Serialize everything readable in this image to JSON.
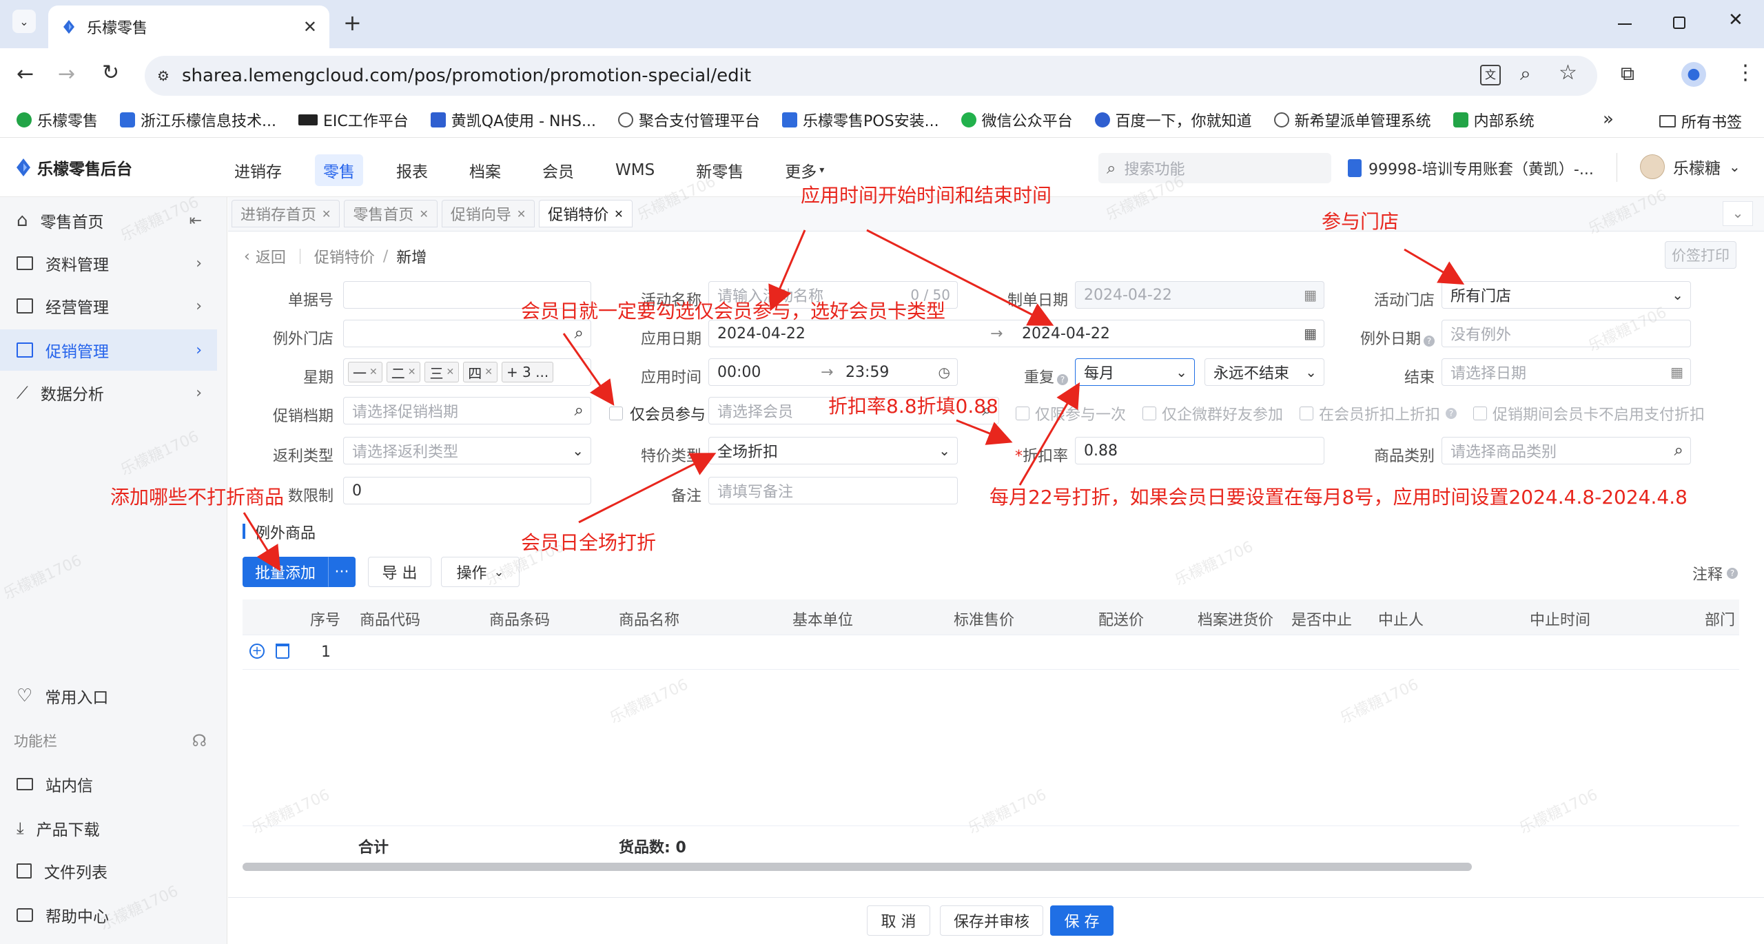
{
  "browser": {
    "tab_title": "乐檬零售",
    "url": "sharea.lemengcloud.com/pos/promotion/promotion-special/edit",
    "bookmarks": [
      {
        "label": "乐檬零售",
        "color": "#22a447"
      },
      {
        "label": "浙江乐檬信息技术...",
        "color": "#2f6bdc"
      },
      {
        "label": "EIC工作平台",
        "color": "#222222"
      },
      {
        "label": "黄凯QA使用 - NHS...",
        "color": "#2f5fd0"
      },
      {
        "label": "聚合支付管理平台",
        "color": "#555555"
      },
      {
        "label": "乐檬零售POS安装...",
        "color": "#2f6bdc"
      },
      {
        "label": "微信公众平台",
        "color": "#22b14c"
      },
      {
        "label": "百度一下，你就知道",
        "color": "#2f5fd0"
      },
      {
        "label": "新希望派单管理系统",
        "color": "#555555"
      },
      {
        "label": "内部系统",
        "color": "#22a447"
      }
    ],
    "all_bookmarks": "所有书签",
    "more_bookmarks": "»"
  },
  "app": {
    "logo": "乐檬零售后台",
    "nav": [
      "进销存",
      "零售",
      "报表",
      "档案",
      "会员",
      "WMS",
      "新零售",
      "更多"
    ],
    "nav_active": "零售",
    "search_placeholder": "搜索功能",
    "account": "99998-培训专用账套（黄凯）-...",
    "user": "乐檬糖"
  },
  "sidebar": {
    "items": [
      {
        "label": "零售首页",
        "icon": "home-icon"
      },
      {
        "label": "资料管理",
        "icon": "folder-icon"
      },
      {
        "label": "经营管理",
        "icon": "chart-box-icon"
      },
      {
        "label": "促销管理",
        "icon": "promotion-icon"
      },
      {
        "label": "数据分析",
        "icon": "line-chart-icon"
      }
    ],
    "favorites": "常用入口",
    "function_bar": "功能栏",
    "bottom_items": [
      {
        "label": "站内信",
        "icon": "mail-icon"
      },
      {
        "label": "产品下载",
        "icon": "download-icon"
      },
      {
        "label": "文件列表",
        "icon": "file-list-icon"
      },
      {
        "label": "帮助中心",
        "icon": "help-icon"
      }
    ]
  },
  "tabs": [
    "进销存首页",
    "零售首页",
    "促销向导",
    "促销特价"
  ],
  "breadcrumb": {
    "back": "返回",
    "parent": "促销特价",
    "current": "新增"
  },
  "price_print": "价签打印",
  "form": {
    "doc_no": {
      "label": "单据号",
      "value": ""
    },
    "activity_name": {
      "label": "活动名称",
      "placeholder": "请输入活动名称",
      "counter": "0 / 50"
    },
    "create_date": {
      "label": "制单日期",
      "value": "2024-04-22"
    },
    "activity_store": {
      "label": "活动门店",
      "value": "所有门店"
    },
    "exception_store": {
      "label": "例外门店",
      "value": ""
    },
    "apply_date": {
      "label": "应用日期",
      "start": "2024-04-22",
      "end": "2024-04-22",
      "sep": "→"
    },
    "exception_date": {
      "label": "例外日期",
      "placeholder": "没有例外"
    },
    "weekday": {
      "label": "星期",
      "tags": [
        "一",
        "二",
        "三",
        "四"
      ],
      "more": "+ 3 ..."
    },
    "apply_time": {
      "label": "应用时间",
      "start": "00:00",
      "end": "23:59",
      "sep": "→"
    },
    "repeat": {
      "label": "重复",
      "value": "每月",
      "end_mode": "永远不结束"
    },
    "end": {
      "label": "结束",
      "placeholder": "请选择日期"
    },
    "promo_file": {
      "label": "促销档期",
      "placeholder": "请选择促销档期"
    },
    "member_only": {
      "label": "仅会员参与",
      "placeholder": "请选择会员"
    },
    "options": [
      "仅限参与一次",
      "仅企微群好友参加",
      "在会员折扣上折扣",
      "促销期间会员卡不启用支付折扣"
    ],
    "rebate_type": {
      "label": "返利类型",
      "placeholder": "请选择返利类型"
    },
    "special_type": {
      "label": "特价类型",
      "value": "全场折扣"
    },
    "discount": {
      "label": "折扣率",
      "value": "0.88",
      "required": "*"
    },
    "goods_category": {
      "label": "商品类别",
      "placeholder": "请选择商品类别"
    },
    "count_limit": {
      "label": "数限制",
      "value": "0"
    },
    "remark": {
      "label": "备注",
      "placeholder": "请填写备注"
    }
  },
  "section": {
    "title": "例外商品",
    "batch_add": "批量添加",
    "more": "···",
    "export": "导 出",
    "operation": "操作",
    "note": "注释"
  },
  "table": {
    "columns": [
      "序号",
      "商品代码",
      "商品条码",
      "商品名称",
      "基本单位",
      "标准售价",
      "配送价",
      "档案进货价",
      "是否中止",
      "中止人",
      "中止时间",
      "部门"
    ],
    "rows": [
      {
        "index": "1"
      }
    ],
    "total_label": "合计",
    "goods_count": "货品数: 0"
  },
  "footer": {
    "cancel": "取 消",
    "save_review": "保存并审核",
    "save": "保 存"
  },
  "annotations": {
    "time_range": "应用时间开始时间和结束时间",
    "stores": "参与门店",
    "member_day": "会员日就一定要勾选仅会员参与，选好会员卡类型",
    "discount_fill": "折扣率8.8折填0.88",
    "exception_goods": "添加哪些不打折商品",
    "monthly_22": "每月22号打折，如果会员日要设置在每月8号，应用时间设置2024.4.8-2024.4.8",
    "member_day_all": "会员日全场打折"
  },
  "watermark": "乐檬糖1706",
  "colors": {
    "primary": "#1f6fe5",
    "annotation": "#e8261d",
    "active_bg": "#e3ebf8"
  }
}
